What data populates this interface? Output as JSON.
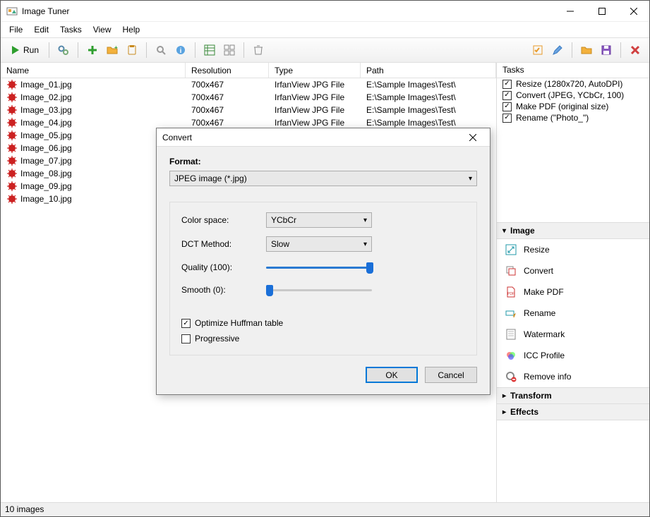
{
  "window": {
    "title": "Image Tuner"
  },
  "menu": [
    "File",
    "Edit",
    "Tasks",
    "View",
    "Help"
  ],
  "toolbar": {
    "run": "Run"
  },
  "columns": {
    "name": "Name",
    "resolution": "Resolution",
    "type": "Type",
    "path": "Path"
  },
  "files": [
    {
      "name": "Image_01.jpg",
      "res": "700x467",
      "type": "IrfanView JPG File",
      "path": "E:\\Sample Images\\Test\\"
    },
    {
      "name": "Image_02.jpg",
      "res": "700x467",
      "type": "IrfanView JPG File",
      "path": "E:\\Sample Images\\Test\\"
    },
    {
      "name": "Image_03.jpg",
      "res": "700x467",
      "type": "IrfanView JPG File",
      "path": "E:\\Sample Images\\Test\\"
    },
    {
      "name": "Image_04.jpg",
      "res": "700x467",
      "type": "IrfanView JPG File",
      "path": "E:\\Sample Images\\Test\\"
    },
    {
      "name": "Image_05.jpg",
      "res": "",
      "type": "",
      "path": ""
    },
    {
      "name": "Image_06.jpg",
      "res": "",
      "type": "",
      "path": ""
    },
    {
      "name": "Image_07.jpg",
      "res": "",
      "type": "",
      "path": ""
    },
    {
      "name": "Image_08.jpg",
      "res": "",
      "type": "",
      "path": ""
    },
    {
      "name": "Image_09.jpg",
      "res": "",
      "type": "",
      "path": ""
    },
    {
      "name": "Image_10.jpg",
      "res": "",
      "type": "",
      "path": ""
    }
  ],
  "tasks_header": "Tasks",
  "tasks": [
    "Resize (1280x720, AutoDPI)",
    "Convert (JPEG, YCbCr, 100)",
    "Make PDF (original size)",
    "Rename (\"Photo_\")"
  ],
  "accordion": {
    "image": "Image",
    "transform": "Transform",
    "effects": "Effects"
  },
  "actions": [
    "Resize",
    "Convert",
    "Make PDF",
    "Rename",
    "Watermark",
    "ICC Profile",
    "Remove info"
  ],
  "status": "10 images",
  "dialog": {
    "title": "Convert",
    "format_label": "Format:",
    "format_value": "JPEG image (*.jpg)",
    "color_space_label": "Color space:",
    "color_space_value": "YCbCr",
    "dct_label": "DCT Method:",
    "dct_value": "Slow",
    "quality_label": "Quality (100):",
    "smooth_label": "Smooth (0):",
    "opt_huffman": "Optimize Huffman table",
    "progressive": "Progressive",
    "ok": "OK",
    "cancel": "Cancel"
  }
}
